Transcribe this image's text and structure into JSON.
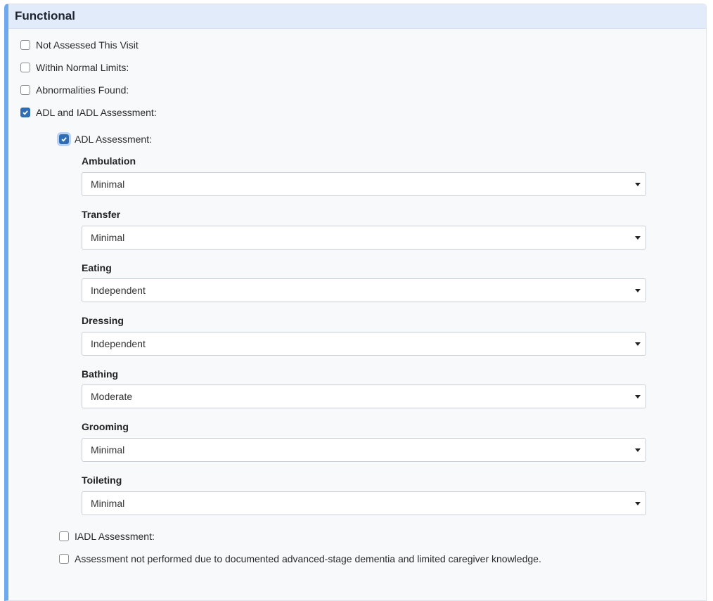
{
  "section": {
    "title": "Functional"
  },
  "options": [
    {
      "label": "Not Assessed This Visit",
      "checked": false
    },
    {
      "label": "Within Normal Limits:",
      "checked": false
    },
    {
      "label": "Abnormalities Found:",
      "checked": false
    },
    {
      "label": "ADL and IADL Assessment:",
      "checked": true
    }
  ],
  "adl": {
    "label": "ADL Assessment:",
    "checked": true,
    "fields": [
      {
        "label": "Ambulation",
        "value": "Minimal"
      },
      {
        "label": "Transfer",
        "value": "Minimal"
      },
      {
        "label": "Eating",
        "value": "Independent"
      },
      {
        "label": "Dressing",
        "value": "Independent"
      },
      {
        "label": "Bathing",
        "value": "Moderate"
      },
      {
        "label": "Grooming",
        "value": "Minimal"
      },
      {
        "label": "Toileting",
        "value": "Minimal"
      }
    ]
  },
  "iadl": {
    "label": "IADL Assessment:",
    "checked": false
  },
  "not_performed": {
    "label": "Assessment not performed due to documented advanced-stage dementia and limited caregiver knowledge.",
    "checked": false
  },
  "colors": {
    "accent": "#6ea8ee",
    "header_bg": "#e2ebfa",
    "checkbox_checked": "#2f6db5"
  }
}
